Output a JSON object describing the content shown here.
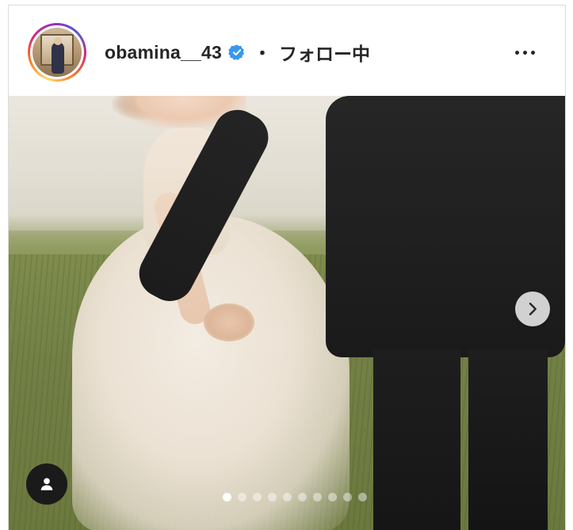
{
  "post": {
    "username": "obamina__43",
    "verified": true,
    "separator": "・",
    "follow_status": "フォロー中",
    "more_icon": "more-horizontal-icon",
    "avatar_icon": "profile-avatar",
    "carousel": {
      "total": 10,
      "current": 1
    },
    "next_icon": "chevron-right-icon",
    "tag_icon": "user-tag-icon"
  },
  "colors": {
    "verified_badge": "#3897f0",
    "text": "#262626",
    "border": "#dbdbdb"
  }
}
